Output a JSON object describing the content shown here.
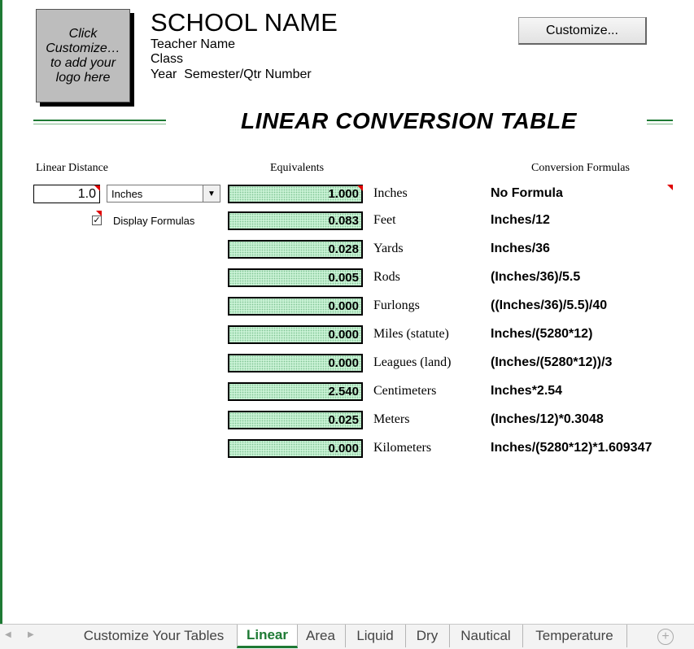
{
  "header": {
    "logo_text": "Click Customize… to add your logo here",
    "school_name": "SCHOOL NAME",
    "teacher": "Teacher Name",
    "class": "Class",
    "year_line": "Year  Semester/Qtr Number",
    "customize_label": "Customize..."
  },
  "title": "LINEAR CONVERSION TABLE",
  "columns": {
    "linear_distance": "Linear Distance",
    "equivalents": "Equivalents",
    "formulas": "Conversion Formulas"
  },
  "input": {
    "value": "1.0",
    "unit": "Inches",
    "display_formulas_label": "Display Formulas",
    "display_formulas_checked": true
  },
  "rows": [
    {
      "value": "1.000",
      "unit": "Inches",
      "formula": "No Formula"
    },
    {
      "value": "0.083",
      "unit": "Feet",
      "formula": "Inches/12"
    },
    {
      "value": "0.028",
      "unit": "Yards",
      "formula": "Inches/36"
    },
    {
      "value": "0.005",
      "unit": "Rods",
      "formula": "(Inches/36)/5.5"
    },
    {
      "value": "0.000",
      "unit": "Furlongs",
      "formula": "((Inches/36)/5.5)/40"
    },
    {
      "value": "0.000",
      "unit": "Miles (statute)",
      "formula": "Inches/(5280*12)"
    },
    {
      "value": "0.000",
      "unit": "Leagues (land)",
      "formula": "(Inches/(5280*12))/3"
    },
    {
      "value": "2.540",
      "unit": "Centimeters",
      "formula": "Inches*2.54"
    },
    {
      "value": "0.025",
      "unit": "Meters",
      "formula": "(Inches/12)*0.3048"
    },
    {
      "value": "0.000",
      "unit": "Kilometers",
      "formula": "Inches/(5280*12)*1.609347"
    }
  ],
  "tabs": [
    {
      "label": "Customize Your Tables",
      "active": false
    },
    {
      "label": "Linear",
      "active": true
    },
    {
      "label": "Area",
      "active": false
    },
    {
      "label": "Liquid",
      "active": false
    },
    {
      "label": "Dry",
      "active": false
    },
    {
      "label": "Nautical",
      "active": false
    },
    {
      "label": "Temperature",
      "active": false
    }
  ],
  "colors": {
    "accent": "#1e7a34",
    "cell_fill": "#c9f2d5",
    "comment_marker": "#e00000"
  }
}
